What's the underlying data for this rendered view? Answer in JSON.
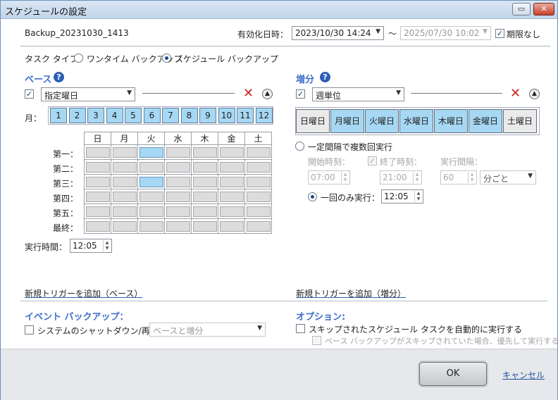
{
  "window": {
    "title": "スケジュールの設定"
  },
  "header": {
    "task_name": "Backup_20231030_1413",
    "effective_label": "有効化日時：",
    "start_datetime": "2023/10/30 14:24",
    "tilde": "～",
    "end_datetime": "2025/07/30 10:02",
    "no_limit_label": "期限なし",
    "no_limit_checked": true
  },
  "task_type": {
    "label": "タスク タイプ：",
    "one_time": "ワンタイム バックアップ",
    "scheduled": "スケジュール バックアップ",
    "selected": "scheduled"
  },
  "base": {
    "title": "ベース",
    "mode": "指定曜日",
    "month_label": "月：",
    "months": [
      "1",
      "2",
      "3",
      "4",
      "5",
      "6",
      "7",
      "8",
      "9",
      "10",
      "11",
      "12"
    ],
    "weekdays": [
      "日",
      "月",
      "火",
      "水",
      "木",
      "金",
      "土"
    ],
    "weeks": [
      "第一：",
      "第二：",
      "第三：",
      "第四：",
      "第五：",
      "最終："
    ],
    "selected_cells": [
      [
        0,
        2
      ],
      [
        2,
        2
      ]
    ],
    "exec_time_label": "実行時間：",
    "exec_time": "12:05",
    "add_trigger": "新規トリガーを追加（ベース）"
  },
  "incremental": {
    "title": "増分",
    "mode": "週単位",
    "days": [
      {
        "label": "日曜日",
        "on": false
      },
      {
        "label": "月曜日",
        "on": true
      },
      {
        "label": "火曜日",
        "on": true
      },
      {
        "label": "水曜日",
        "on": true
      },
      {
        "label": "木曜日",
        "on": true
      },
      {
        "label": "金曜日",
        "on": true
      },
      {
        "label": "土曜日",
        "on": false
      }
    ],
    "repeat_label": "一定間隔で複数回実行",
    "start_label": "開始時刻：",
    "end_label": "終了時刻：",
    "interval_label": "実行間隔：",
    "start_time": "07:00",
    "end_time": "21:00",
    "interval_value": "60",
    "interval_unit": "分ごと",
    "once_label": "一回のみ実行：",
    "once_time": "12:05",
    "add_trigger": "新規トリガーを追加（増分）"
  },
  "event": {
    "title": "イベント バックアップ：",
    "shutdown_label": "システムのシャットダウン/再起動",
    "shutdown_option": "ベースと増分"
  },
  "options": {
    "title": "オプション:",
    "skip_label": "スキップされたスケジュール タスクを自動的に実行する",
    "prefer_label": "ベース バックアップがスキップされていた場合、優先して実行する"
  },
  "footer": {
    "ok": "OK",
    "cancel": "キャンセル"
  }
}
